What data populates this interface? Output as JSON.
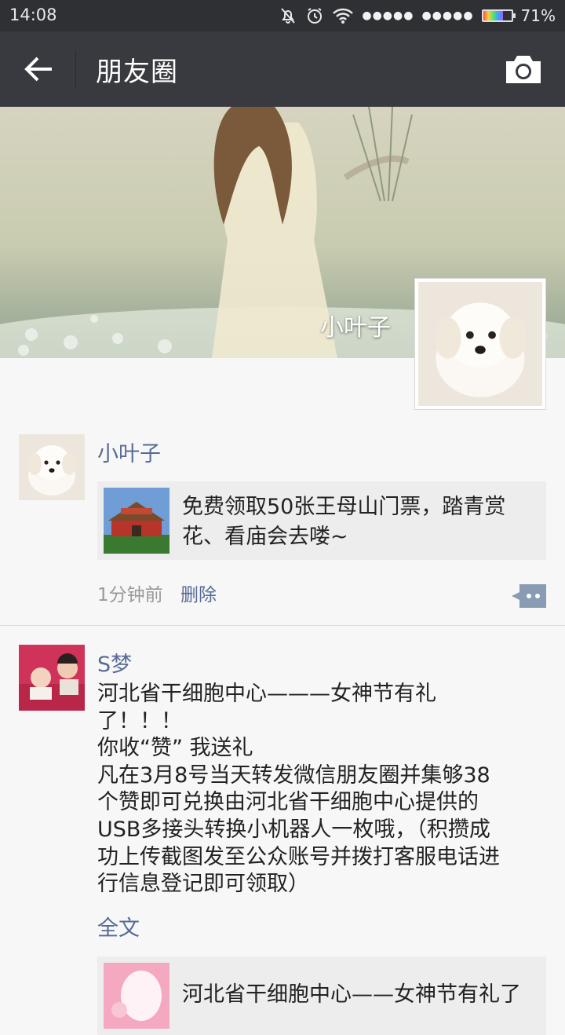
{
  "status_bar": {
    "time": "14:08",
    "signal1": "●●●●●",
    "signal2": "●●●●●",
    "battery_percent": "71%",
    "battery_level": 0.71
  },
  "header": {
    "title": "朋友圈"
  },
  "cover": {
    "user_name": "小叶子"
  },
  "posts": [
    {
      "nickname": "小叶子",
      "link_title_lines": [
        "免费领取50张王母山门票，踏青赏",
        "花、看庙会去喽~"
      ],
      "time": "1分钟前",
      "delete_label": "删除"
    },
    {
      "nickname": "S梦",
      "text_lines": [
        "河北省干细胞中心———女神节有礼",
        "了！！！",
        "你收“赞” 我送礼",
        "凡在3月8号当天转发微信朋友圈并集够38",
        "个赞即可兑换由河北省干细胞中心提供的",
        "USB多接头转换小机器人一枚哦，（积攒成",
        "功上传截图发至公众账号并拨打客服电话进",
        "行信息登记即可领取）"
      ],
      "full_text_label": "全文",
      "link_title": "河北省干细胞中心——女神节有礼了"
    }
  ]
}
